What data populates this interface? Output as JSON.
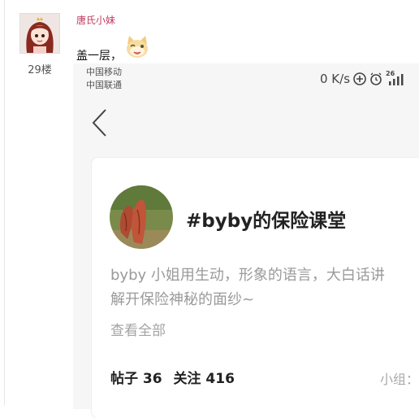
{
  "post": {
    "username": "唐氏小妹",
    "floor": "29楼",
    "text": "盖一层，",
    "avatar_icon": "anime-girl-avatar",
    "emoji_icon": "grinning-cat-emoji"
  },
  "embedded_screenshot": {
    "carrier_line1": "中国移动",
    "carrier_line2": "中国联通",
    "network_speed": "0 K/s",
    "status_icons": [
      "data-saver-icon",
      "alarm-icon",
      "signal-26-icon"
    ],
    "network_label": "26",
    "back_icon": "chevron-left-icon",
    "topic": {
      "title": "#byby的保险课堂",
      "description_line1": "byby 小姐用生动，形象的语言，大白话讲",
      "description_line2": "解开保险神秘的面纱~",
      "more_label": "查看全部",
      "posts_label": "帖子 36",
      "follows_label": "关注 416",
      "group_label": "小组："
    }
  },
  "colors": {
    "username": "#c03a5d",
    "title": "#222222",
    "muted": "#9a9a9a"
  }
}
